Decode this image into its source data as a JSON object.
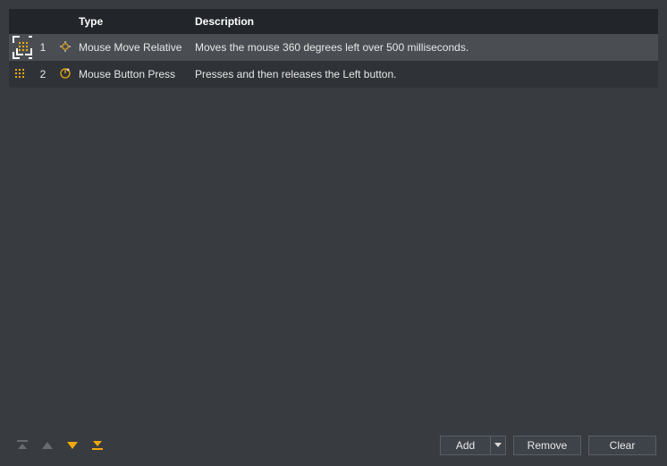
{
  "colors": {
    "accent": "#f0a80c",
    "text": "#e6e6e6",
    "bg": "#383c41",
    "header_bg": "#22262a",
    "row_selected": "#4a4e53",
    "row_alt": "#2f3338",
    "button_bg": "#3e434a",
    "button_border": "#5a5f66"
  },
  "table": {
    "headers": {
      "type": "Type",
      "description": "Description"
    },
    "rows": [
      {
        "index": "1",
        "icon": "mouse-move-icon",
        "type": "Mouse Move Relative",
        "description": "Moves the mouse 360 degrees left over 500 milliseconds.",
        "selected": true
      },
      {
        "index": "2",
        "icon": "mouse-press-icon",
        "type": "Mouse Button Press",
        "description": "Presses and then releases the Left button.",
        "selected": false
      }
    ]
  },
  "toolbar": {
    "move_top": "Move to top",
    "move_up": "Move up",
    "move_down": "Move down",
    "move_bottom": "Move to bottom",
    "add": "Add",
    "remove": "Remove",
    "clear": "Clear"
  }
}
